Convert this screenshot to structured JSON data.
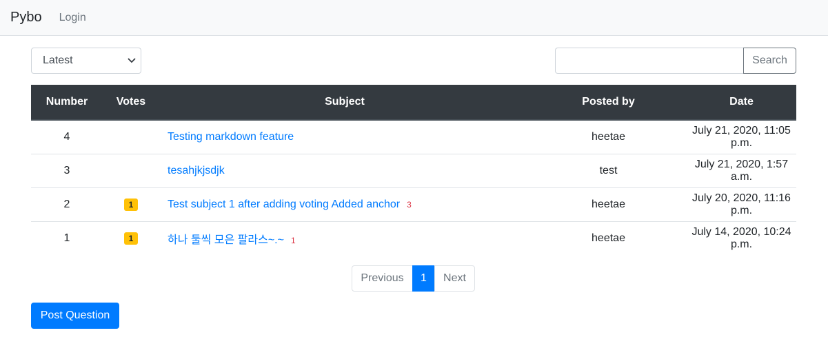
{
  "navbar": {
    "brand": "Pybo",
    "login": "Login"
  },
  "toolbar": {
    "sort_value": "Latest",
    "search_value": "",
    "search_label": "Search"
  },
  "table": {
    "headers": [
      "Number",
      "Votes",
      "Subject",
      "Posted by",
      "Date"
    ],
    "rows": [
      {
        "number": "4",
        "votes": "",
        "subject": "Testing markdown feature",
        "answers": "",
        "author": "heetae",
        "date": "July 21, 2020, 11:05 p.m."
      },
      {
        "number": "3",
        "votes": "",
        "subject": "tesahjkjsdjk",
        "answers": "",
        "author": "test",
        "date": "July 21, 2020, 1:57 a.m."
      },
      {
        "number": "2",
        "votes": "1",
        "subject": "Test subject 1 after adding voting Added anchor",
        "answers": "3",
        "author": "heetae",
        "date": "July 20, 2020, 11:16 p.m."
      },
      {
        "number": "1",
        "votes": "1",
        "subject": "하나 둘씩 모은 팔라스~.~",
        "answers": "1",
        "author": "heetae",
        "date": "July 14, 2020, 10:24 p.m."
      }
    ]
  },
  "pagination": {
    "previous": "Previous",
    "current": "1",
    "next": "Next"
  },
  "post_button": "Post Question",
  "colors": {
    "primary": "#007bff",
    "header_bg": "#343a40",
    "vote_badge": "#ffc107",
    "answer_count": "#dc3545"
  }
}
